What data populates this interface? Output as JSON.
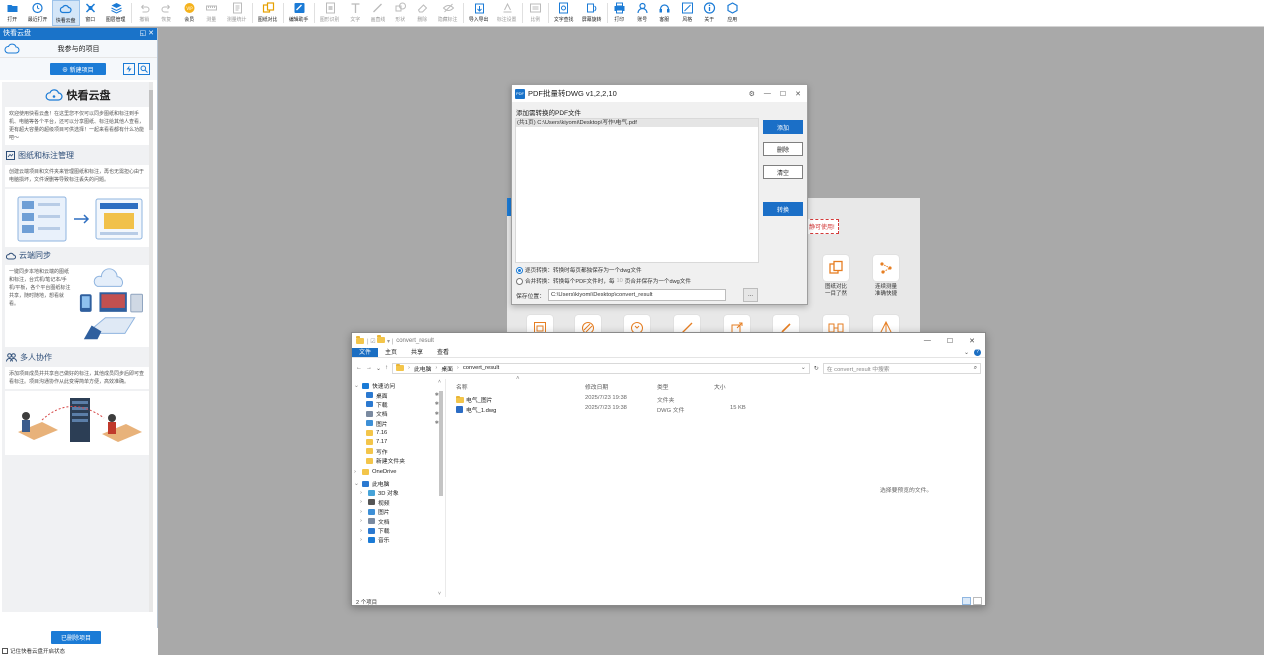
{
  "toolbar": {
    "items": [
      {
        "label": "打开",
        "icon": "folder-open-icon"
      },
      {
        "label": "最近打开",
        "icon": "clock-icon"
      },
      {
        "label": "快看云盘",
        "icon": "cloud-icon"
      },
      {
        "label": "窗口",
        "icon": "window-icon"
      },
      {
        "label": "图层管理",
        "icon": "layers-icon"
      },
      {
        "label": "撤销",
        "icon": "undo-icon"
      },
      {
        "label": "恢复",
        "icon": "redo-icon"
      },
      {
        "label": "会员",
        "icon": "vip-icon"
      },
      {
        "label": "测量",
        "icon": "ruler-icon"
      },
      {
        "label": "测量统计",
        "icon": "measure-stats-icon"
      },
      {
        "label": "图纸对比",
        "icon": "compare-icon"
      },
      {
        "label": "编辑助手",
        "icon": "edit-assistant-icon"
      },
      {
        "label": "图形识别",
        "icon": "shape-recognition-icon"
      },
      {
        "label": "文字",
        "icon": "text-icon"
      },
      {
        "label": "画直线",
        "icon": "line-icon"
      },
      {
        "label": "形状",
        "icon": "shape-icon"
      },
      {
        "label": "删除",
        "icon": "eraser-icon"
      },
      {
        "label": "隐藏标注",
        "icon": "hide-annotation-icon"
      },
      {
        "label": "导入导出",
        "icon": "import-export-icon"
      },
      {
        "label": "标注设置",
        "icon": "annotation-settings-icon"
      },
      {
        "label": "比例",
        "icon": "scale-icon"
      },
      {
        "label": "文字查找",
        "icon": "text-search-icon"
      },
      {
        "label": "屏幕旋转",
        "icon": "rotate-screen-icon"
      },
      {
        "label": "打印",
        "icon": "printer-icon"
      },
      {
        "label": "账号",
        "icon": "account-icon"
      },
      {
        "label": "客服",
        "icon": "headset-icon"
      },
      {
        "label": "风格",
        "icon": "style-icon"
      },
      {
        "label": "关于",
        "icon": "info-icon"
      },
      {
        "label": "应用",
        "icon": "apps-icon"
      }
    ]
  },
  "side_panel": {
    "title": "快看云盘",
    "title_controls": "◱ ✕",
    "project_title": "我参与的项目",
    "new_project_button": "⊕ 新建项目",
    "brand": "快看云盘",
    "intro": "欢迎使用快看云盘！在这里您不仅可以同步图纸和标注到手机、电脑等各个平台，还可以分享图纸、标注给其他人查看，更有超大容量的超级项目可供选择！一起来看看都有什么功能吧～",
    "section1_title": "图纸和标注管理",
    "section1_text": "创建云端项目和文件夹来管理图纸和标注，再也无需担心由于电脑损坏，文件误删等导致标注丢失的问题。",
    "section2_title": "云端同步",
    "section2_text": "一键同步本地和云端的图纸和标注，台式机/笔记本/手机/平板，各个平台图纸标注共享，随时随地，想看就看。",
    "section3_title": "多人协作",
    "section3_text": "添加项目成员并共享自己做好的标注，其他成员同步后即可查看标注。项目沟通协作从此变得简单方便，高效准确。",
    "deleted_button": "已删除项目",
    "remember_label": "记住快看云盘开启状态"
  },
  "bg_window": {
    "tag_text": "静可使用!",
    "features": [
      {
        "label": "图纸对比\n一目了然"
      },
      {
        "label": "连续测量\n准确快捷"
      }
    ]
  },
  "pdf_dialog": {
    "title": "PDF批量转DWG  v1,2,2,10",
    "controls": [
      "⚙",
      "—",
      "☐",
      "✕"
    ],
    "list_label": "添加需转换的PDF文件",
    "files": [
      "(共1页) C:\\Users\\kiyomi\\Desktop\\写作\\电气.pdf"
    ],
    "buttons": {
      "add": "添加",
      "delete": "删除",
      "clear": "清空",
      "convert": "转换"
    },
    "option1": "逐页转换：转换时每页都独保存为一个dwg文件",
    "option2": "合并转换：转换每个PDF文件时，每",
    "option2_num": "10",
    "option2_suffix": "页合并保存为一个dwg文件",
    "save_label": "保存位置：",
    "save_path": "C:\\Users\\kiyomi\\Desktop\\convert_result",
    "browse": "..."
  },
  "explorer": {
    "title": "convert_result",
    "window_controls": [
      "—",
      "☐",
      "✕"
    ],
    "ribbon_tabs": [
      "文件",
      "主页",
      "共享",
      "查看"
    ],
    "breadcrumb": [
      "此电脑",
      "桌面",
      "convert_result"
    ],
    "search_placeholder": "在 convert_result 中搜索",
    "nav_items": [
      {
        "label": "快速访问",
        "icon": "star-icon",
        "pinned": false
      },
      {
        "label": "桌面",
        "icon": "desktop-icon",
        "pinned": true
      },
      {
        "label": "下载",
        "icon": "download-icon",
        "pinned": true
      },
      {
        "label": "文档",
        "icon": "document-icon",
        "pinned": true
      },
      {
        "label": "图片",
        "icon": "picture-icon",
        "pinned": true
      },
      {
        "label": "7.16",
        "icon": "folder-icon",
        "pinned": false
      },
      {
        "label": "7.17",
        "icon": "folder-icon",
        "pinned": false
      },
      {
        "label": "写作",
        "icon": "folder-icon",
        "pinned": false
      },
      {
        "label": "新建文件夹",
        "icon": "folder-icon",
        "pinned": false
      },
      {
        "label": "OneDrive",
        "icon": "cloud-folder-icon",
        "pinned": false
      },
      {
        "label": "此电脑",
        "icon": "computer-icon",
        "pinned": false
      },
      {
        "label": "3D 对象",
        "icon": "cube-icon",
        "pinned": false
      },
      {
        "label": "视频",
        "icon": "video-icon",
        "pinned": false
      },
      {
        "label": "图片",
        "icon": "picture-icon",
        "pinned": false
      },
      {
        "label": "文档",
        "icon": "document-icon",
        "pinned": false
      },
      {
        "label": "下载",
        "icon": "download-icon",
        "pinned": false
      },
      {
        "label": "音乐",
        "icon": "music-icon",
        "pinned": false
      }
    ],
    "columns": [
      "名称",
      "修改日期",
      "类型",
      "大小"
    ],
    "files": [
      {
        "name": "电气_图片",
        "date": "2025/7/23 19:38",
        "type": "文件夹",
        "size": "",
        "icon": "folder-icon"
      },
      {
        "name": "电气_1.dwg",
        "date": "2025/7/23 19:38",
        "type": "DWG 文件",
        "size": "15 KB",
        "icon": "dwg-file-icon"
      }
    ],
    "empty_hint": "选择要预览的文件。",
    "status": "2 个项目"
  },
  "colors": {
    "accent": "#1b7bd6",
    "title_bar": "#1a73c9",
    "desktop_bg": "#a9a9a9"
  }
}
